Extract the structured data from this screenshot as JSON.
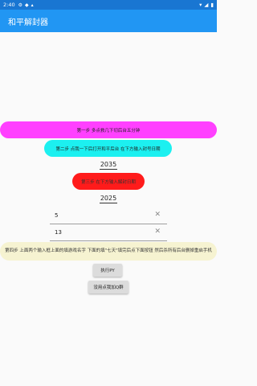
{
  "status": {
    "time": "2:40"
  },
  "appbar": {
    "title": "和平解封器"
  },
  "steps": {
    "step1": "第一步 多点救几下切后台五分钟",
    "step2": "第二步 点我一下后打开和平后台 在下方输入封号日期",
    "step3": "第三步 在下方输入解封日期"
  },
  "years": {
    "ban_year": "2035",
    "unban_year": "2025"
  },
  "fields": {
    "field1_value": "5",
    "field2_value": "13"
  },
  "notice": "第四步 上面两个输入框上面的填游戏名字 下面的填\"七天\"填完后点下面按钮 然后杀所有后台删掉重启手机",
  "buttons": {
    "run": "执行PY",
    "qq": "没用点我加Q群"
  }
}
